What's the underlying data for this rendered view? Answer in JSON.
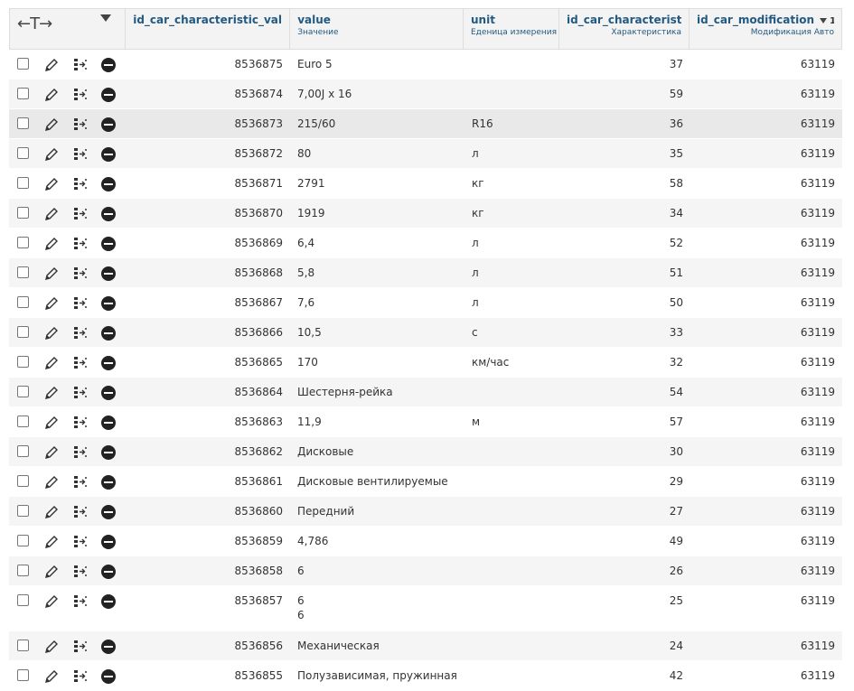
{
  "header": {
    "arrows_label": "←T→",
    "columns": [
      {
        "name": "id_car_characteristic_value",
        "sub": ""
      },
      {
        "name": "value",
        "sub": "Значение"
      },
      {
        "name": "unit",
        "sub": "Еденица измерения"
      },
      {
        "name": "id_car_characteristic",
        "sub": "Характеристика"
      },
      {
        "name": "id_car_modification",
        "sub": "Модификация Авто",
        "sort_index": "1"
      }
    ]
  },
  "row_actions": {
    "edit_icon": "pencil-icon",
    "copy_icon": "copy-row-icon",
    "delete_icon": "delete-icon"
  },
  "rows": [
    {
      "id": "8536875",
      "value": "Euro 5",
      "unit": "",
      "char": "37",
      "mod": "63119"
    },
    {
      "id": "8536874",
      "value": "7,00J x 16",
      "unit": "",
      "char": "59",
      "mod": "63119"
    },
    {
      "id": "8536873",
      "value": "215/60",
      "unit": "R16",
      "char": "36",
      "mod": "63119"
    },
    {
      "id": "8536872",
      "value": "80",
      "unit": "л",
      "char": "35",
      "mod": "63119"
    },
    {
      "id": "8536871",
      "value": "2791",
      "unit": "кг",
      "char": "58",
      "mod": "63119"
    },
    {
      "id": "8536870",
      "value": "1919",
      "unit": "кг",
      "char": "34",
      "mod": "63119"
    },
    {
      "id": "8536869",
      "value": "6,4",
      "unit": "л",
      "char": "52",
      "mod": "63119"
    },
    {
      "id": "8536868",
      "value": "5,8",
      "unit": "л",
      "char": "51",
      "mod": "63119"
    },
    {
      "id": "8536867",
      "value": "7,6",
      "unit": "л",
      "char": "50",
      "mod": "63119"
    },
    {
      "id": "8536866",
      "value": "10,5",
      "unit": "с",
      "char": "33",
      "mod": "63119"
    },
    {
      "id": "8536865",
      "value": "170",
      "unit": "км/час",
      "char": "32",
      "mod": "63119"
    },
    {
      "id": "8536864",
      "value": "Шестерня-рейка",
      "unit": "",
      "char": "54",
      "mod": "63119"
    },
    {
      "id": "8536863",
      "value": "11,9",
      "unit": "м",
      "char": "57",
      "mod": "63119"
    },
    {
      "id": "8536862",
      "value": "Дисковые",
      "unit": "",
      "char": "30",
      "mod": "63119"
    },
    {
      "id": "8536861",
      "value": "Дисковые вентилируемые",
      "unit": "",
      "char": "29",
      "mod": "63119"
    },
    {
      "id": "8536860",
      "value": "Передний",
      "unit": "",
      "char": "27",
      "mod": "63119"
    },
    {
      "id": "8536859",
      "value": "4,786",
      "unit": "",
      "char": "49",
      "mod": "63119"
    },
    {
      "id": "8536858",
      "value": "6",
      "unit": "",
      "char": "26",
      "mod": "63119"
    },
    {
      "id": "8536857",
      "value": "6\n6",
      "unit": "",
      "char": "25",
      "mod": "63119"
    },
    {
      "id": "8536856",
      "value": "Механическая",
      "unit": "",
      "char": "24",
      "mod": "63119"
    },
    {
      "id": "8536855",
      "value": "Полузависимая, пружинная",
      "unit": "",
      "char": "42",
      "mod": "63119"
    }
  ]
}
